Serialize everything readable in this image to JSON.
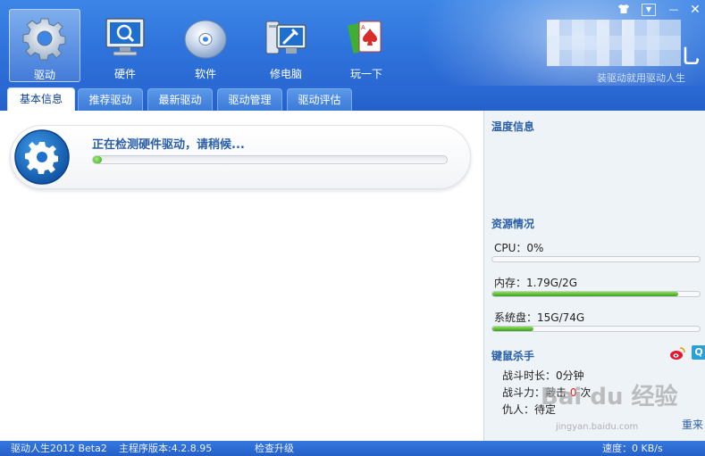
{
  "window": {
    "slogan": "装驱动就用驱动人生",
    "controls": {
      "skin_icon": "shirt-icon",
      "menu_icon": "menu-icon",
      "minimize": "—",
      "close": "✕"
    }
  },
  "nav": [
    {
      "label": "驱动",
      "icon": "gear-icon",
      "active": true
    },
    {
      "label": "硬件",
      "icon": "monitor-search-icon",
      "active": false
    },
    {
      "label": "软件",
      "icon": "cd-disc-icon",
      "active": false
    },
    {
      "label": "修电脑",
      "icon": "repair-tools-icon",
      "active": false
    },
    {
      "label": "玩一下",
      "icon": "playing-cards-icon",
      "active": false
    }
  ],
  "tabs": [
    {
      "label": "基本信息",
      "active": true
    },
    {
      "label": "推荐驱动",
      "active": false
    },
    {
      "label": "最新驱动",
      "active": false
    },
    {
      "label": "驱动管理",
      "active": false
    },
    {
      "label": "驱动评估",
      "active": false
    }
  ],
  "detect": {
    "title": "正在检测硬件驱动，请稍候...",
    "progress": 0.02
  },
  "sidebar": {
    "temperature_title": "温度信息",
    "resource_title": "资源情况",
    "resources": [
      {
        "label": "CPU：0%",
        "fraction": 0.0
      },
      {
        "label": "内存：1.79G/2G",
        "fraction": 0.895
      },
      {
        "label": "系统盘：15G/74G",
        "fraction": 0.2
      }
    ],
    "game_title": "键鼠杀手",
    "battle_time": "战斗时长：0分钟",
    "battle_power_prefix": "战斗力：敲击",
    "battle_power_count": "0",
    "battle_power_suffix": "次",
    "enemy": "仇人：待定",
    "retry": "重来",
    "weibo_icon": "weibo-icon",
    "qq_icon": "qq-icon"
  },
  "status_bar": {
    "product": "驱动人生2012 Beta2",
    "version": "主程序版本:4.2.8.95",
    "update": "检查升级",
    "speed": "速度：0 KB/s"
  },
  "watermark": {
    "text": "Bai du 经验",
    "sub": "jingyan.baidu.com"
  },
  "colors": {
    "accent": "#2a5fa8",
    "header_blue": "#2f74dc",
    "progress_green": "#3c9e1e",
    "danger": "#e02020"
  }
}
